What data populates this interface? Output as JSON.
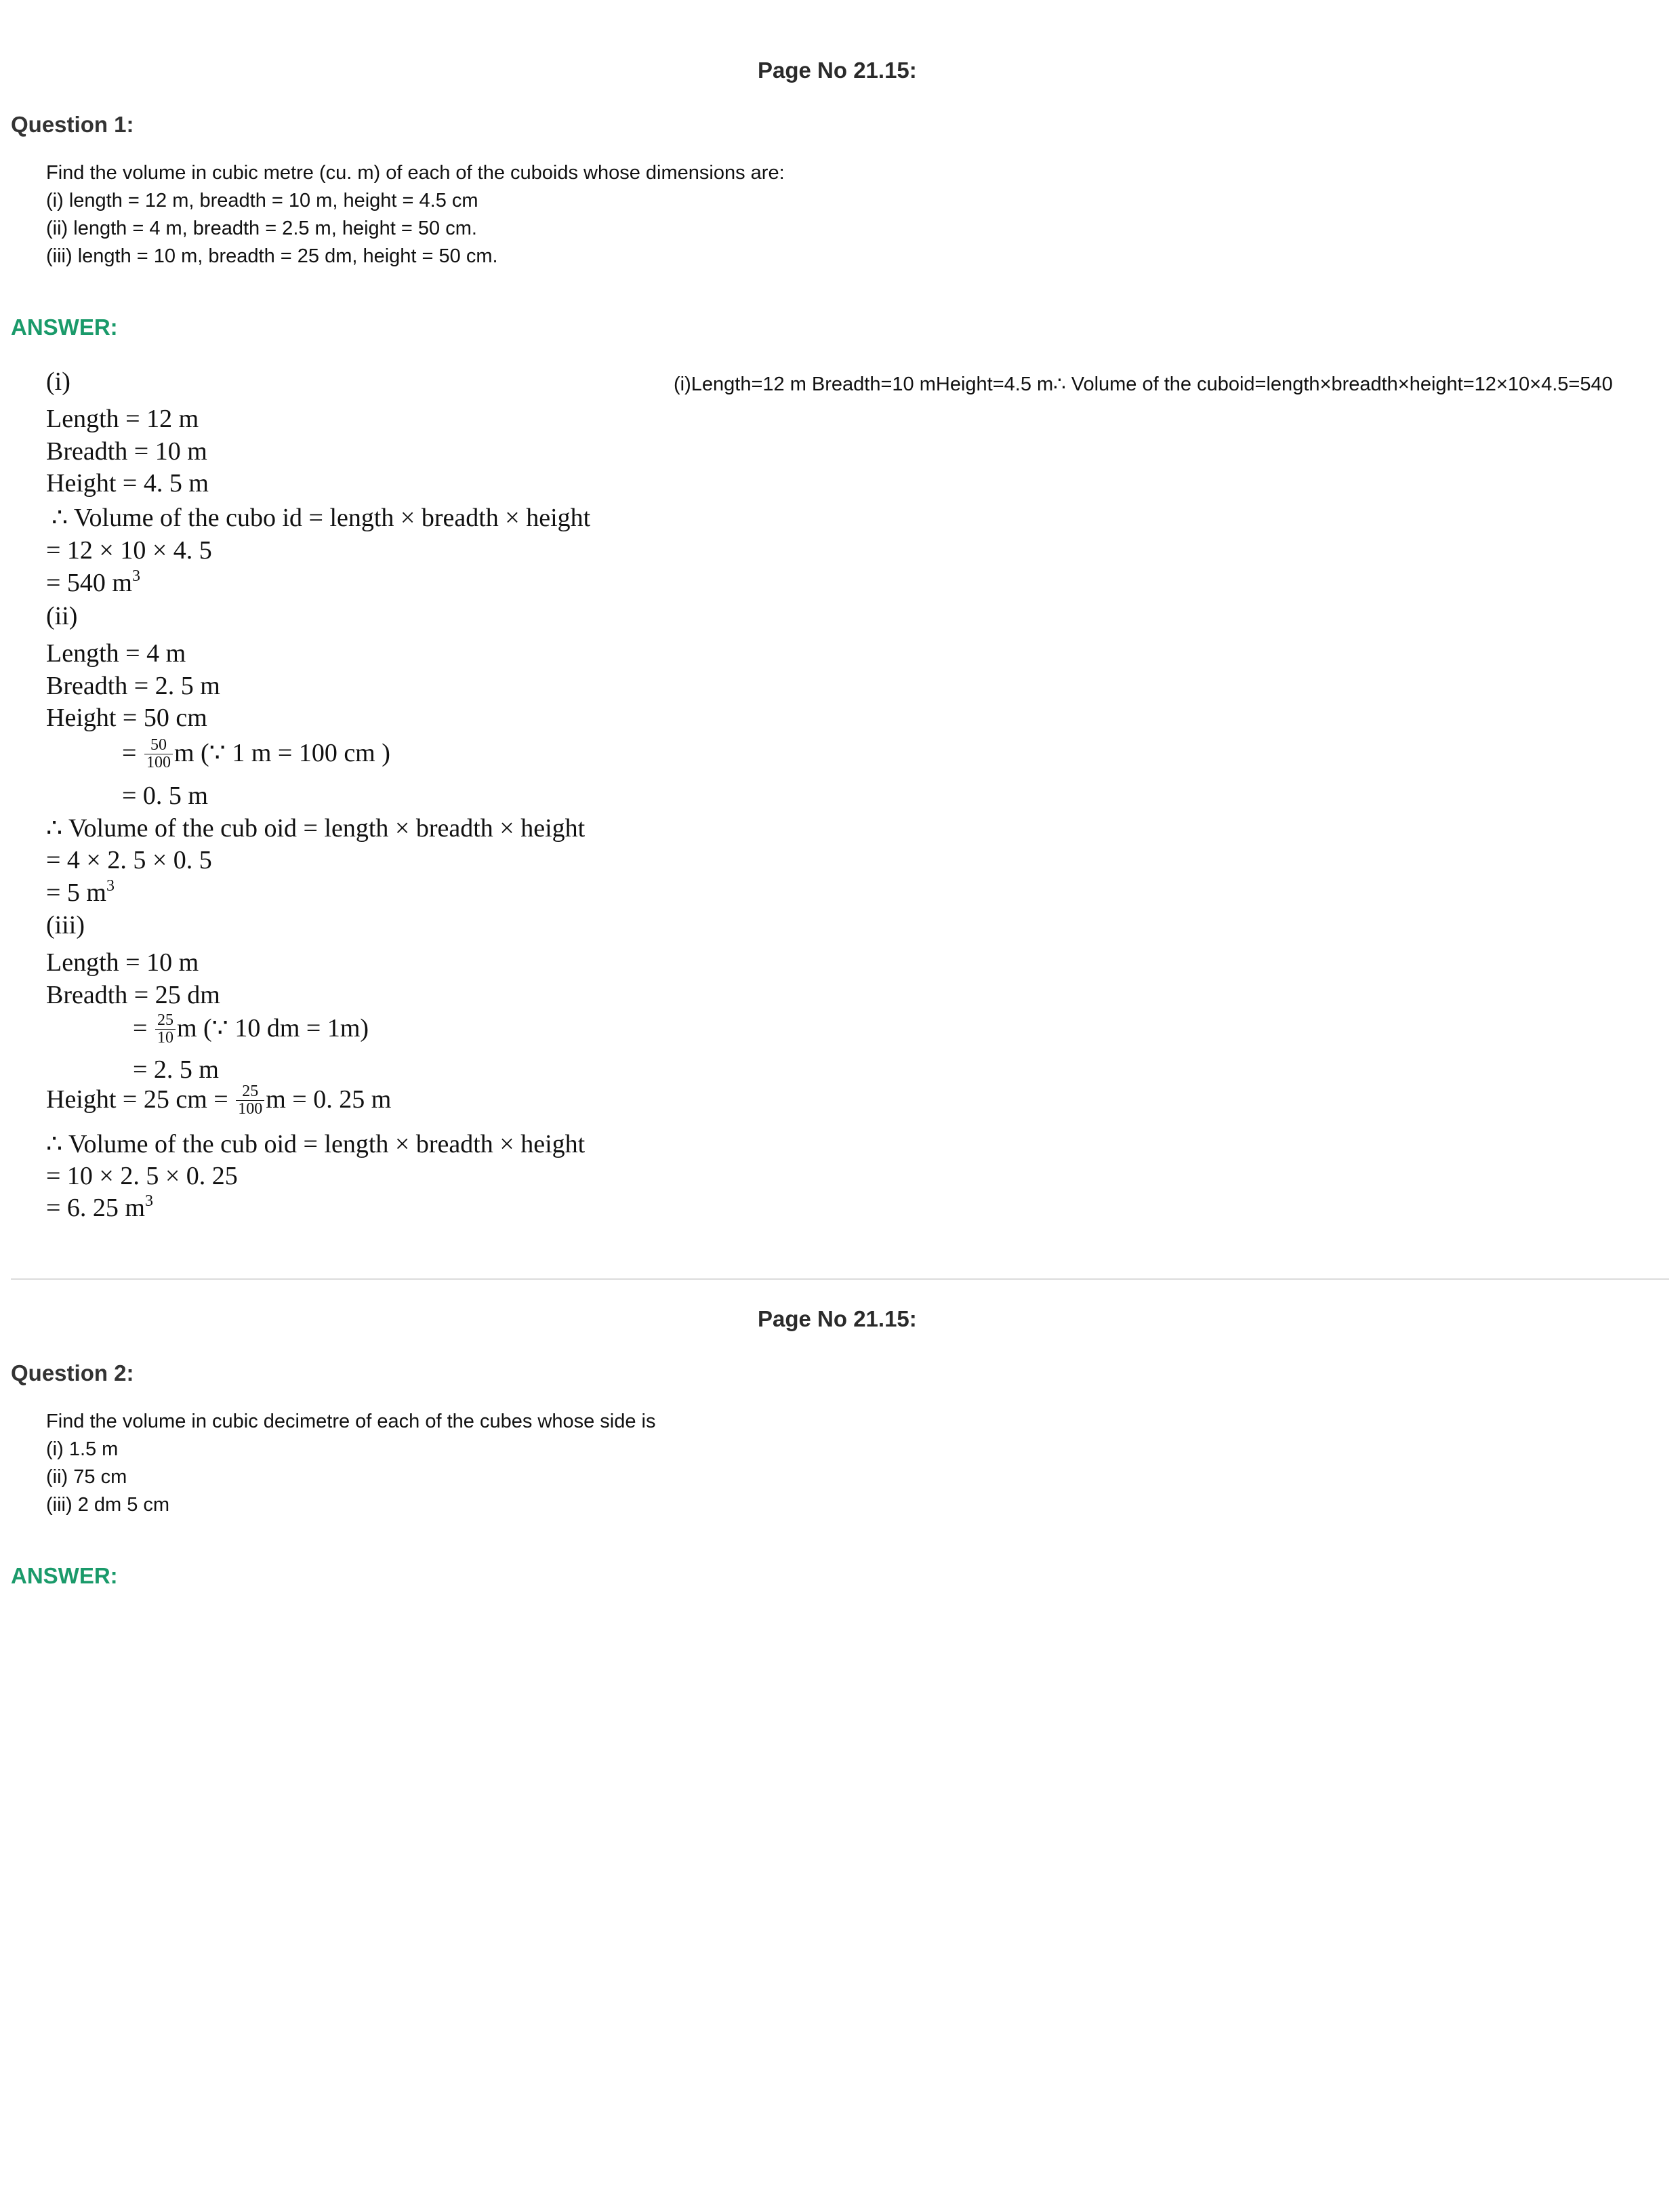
{
  "sections": [
    {
      "page_no": "Page No 21.15:",
      "title": "Question 1:",
      "question_lines": [
        "Find the volume in cubic metre (cu. m) of each of the cuboids whose dimensions are:",
        "(i) length = 12 m, breadth = 10 m, height = 4.5 cm",
        "(ii) length = 4 m, breadth = 2.5 m, height = 50 cm.",
        "(iii) length = 10 m, breadth = 25 dm, height = 50 cm."
      ],
      "answer_label": "ANSWER:",
      "alt_text": "(i)Length=12 m Breadth=10 mHeight=4.5 m∴ Volume of the cuboid=length×breadth×height=12×10×4.5=540",
      "solution": {
        "l1": "(i)",
        "l2": "Length = 12 m",
        "l3": "Breadth = 10 m",
        "l4": "Height = 4. 5 m",
        "l5": "∴  Volume   of   the   cubo id = length × breadth × height",
        "l6": "= 12 × 10 × 4. 5",
        "l7": "= 540 m",
        "l7_sup": "3",
        "l8": "(ii)",
        "l9": "Length = 4 m",
        "l10": "Breadth = 2. 5 m",
        "l11": "Height = 50  cm",
        "l12_a": "=",
        "l12_num": "50",
        "l12_den": "100",
        "l12_b": "m   (∵  1 m   =   100  cm  )",
        "l13": "= 0. 5 m",
        "l14": "∴  Volume  of  the  cub oid = length × breadth × height",
        "l15": "= 4 × 2. 5 × 0. 5",
        "l16": "= 5 m",
        "l16_sup": "3",
        "l17": "(iii)",
        "l18": "Length = 10 m",
        "l19": "Breadth = 25  dm",
        "l20_a": "=",
        "l20_num": "25",
        "l20_den": "10",
        "l20_b": "m (∵  10 dm =  1m)",
        "l21": "= 2. 5 m",
        "l22_a": "Height = 25 cm =",
        "l22_num": "25",
        "l22_den": "100",
        "l22_b": "m = 0. 25 m",
        "l23": "∴  Volume  of  the  cub oid = length × breadth × height",
        "l24": "= 10 × 2. 5 × 0. 25",
        "l25": "= 6. 25 m",
        "l25_sup": "3"
      }
    },
    {
      "page_no": "Page No 21.15:",
      "title": "Question 2:",
      "question_lines": [
        "Find the volume in cubic decimetre of each of the cubes whose side is",
        "(i) 1.5 m",
        "(ii) 75 cm",
        "(iii) 2 dm 5 cm"
      ],
      "answer_label": "ANSWER:"
    }
  ]
}
